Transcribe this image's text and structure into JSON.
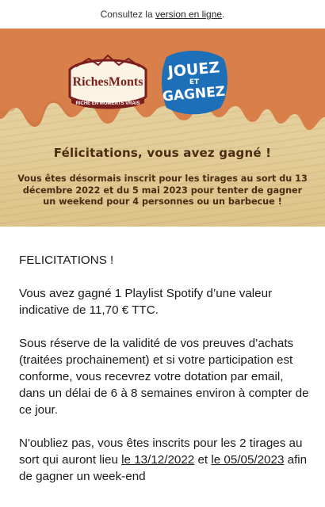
{
  "topbar": {
    "prefix": "Consultez la",
    "link": "version en ligne",
    "suffix": "."
  },
  "banner": {
    "logo_rm": {
      "name": "RichesMonts",
      "tagline": "RICHE EN MOMENTS VRAIS"
    },
    "logo_jg": {
      "line1": "JOUEZ",
      "line2": "ET",
      "line3": "GAGNEZ"
    },
    "title": "Félicitations, vous avez gagné !",
    "text": "Vous êtes désormais inscrit pour les tirages au sort du 13 décembre 2022 et du 5 mai 2023 pour tenter de gagner un weekend pour 4 personnes ou un barbecue !",
    "colors": {
      "caramel": "#d9804a",
      "wood": "#e3cd98",
      "text": "#4a2c12",
      "blue": "#1d6fb8"
    }
  },
  "body": {
    "greeting": "FELICITATIONS !",
    "p1": "Vous avez gagné 1 Playlist Spotify d’une valeur indicative de 11,70 € TTC.",
    "p2": "Sous réserve de la validité de vos preuves d’achats (traitées prochainement) et si votre participation est conforme, vous recevrez votre dotation par email, dans un délai de 6 à 8 semaines environ à compter de ce jour.",
    "p3": {
      "part1": "N'oubliez pas, vous êtes inscrits pour les 2 tirages au sort qui auront lieu ",
      "date1": "le 13/12/2022",
      "part2": " et ",
      "date2": "le 05/05/2023",
      "part3": " afin de gagner un week-end"
    }
  }
}
